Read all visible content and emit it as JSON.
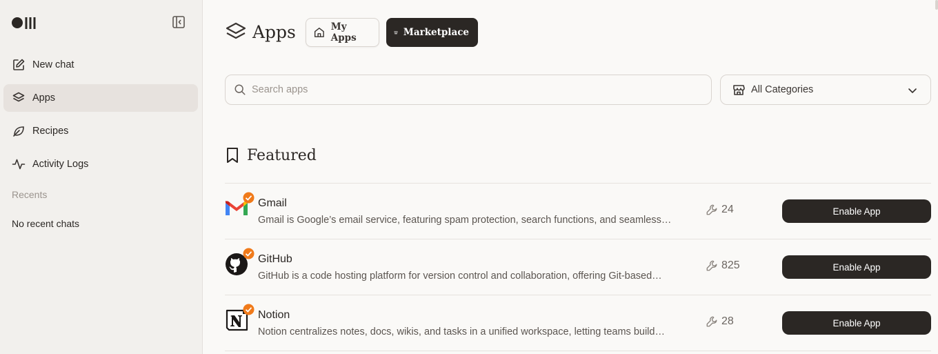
{
  "sidebar": {
    "items": [
      {
        "label": "New chat",
        "icon": "edit-icon"
      },
      {
        "label": "Apps",
        "icon": "layers-icon"
      },
      {
        "label": "Recipes",
        "icon": "leaf-icon"
      },
      {
        "label": "Activity Logs",
        "icon": "activity-icon"
      }
    ],
    "recents_label": "Recents",
    "no_recent": "No recent chats"
  },
  "header": {
    "title": "Apps",
    "tabs": [
      {
        "label": "My Apps",
        "icon": "home-icon"
      },
      {
        "label": "Marketplace",
        "icon": "store-icon"
      }
    ]
  },
  "search": {
    "placeholder": "Search apps",
    "value": ""
  },
  "category": {
    "selected": "All Categories"
  },
  "featured": {
    "title": "Featured",
    "apps": [
      {
        "name": "Gmail",
        "description": "Gmail is Google’s email service, featuring spam protection, search functions, and seamless…",
        "tools": "24",
        "button": "Enable App"
      },
      {
        "name": "GitHub",
        "description": "GitHub is a code hosting platform for version control and collaboration, offering Git-based…",
        "tools": "825",
        "button": "Enable App"
      },
      {
        "name": "Notion",
        "description": "Notion centralizes notes, docs, wikis, and tasks in a unified workspace, letting teams build…",
        "tools": "28",
        "button": "Enable App"
      }
    ]
  },
  "colors": {
    "accent": "#2b2724",
    "verified": "#f07a1a",
    "sidebar_bg": "#f2f0ed",
    "active_bg": "#e7e2de"
  }
}
